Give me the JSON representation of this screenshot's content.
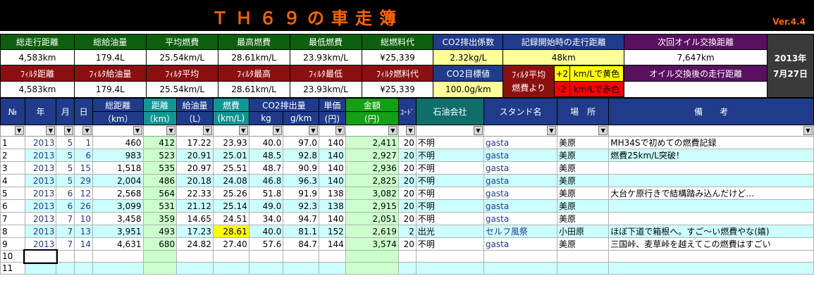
{
  "title": "ＴＨ６９の車走簿",
  "version": "Ver.4.4",
  "summary": {
    "row1": [
      {
        "label": "総走行距離",
        "value": "4,583km"
      },
      {
        "label": "総給油量",
        "value": "179.4L"
      },
      {
        "label": "平均燃費",
        "value": "25.54km/L"
      },
      {
        "label": "最高燃費",
        "value": "28.61km/L"
      },
      {
        "label": "最低燃費",
        "value": "23.93km/L"
      },
      {
        "label": "総燃料代",
        "value": "¥25,339"
      },
      {
        "label": "CO2排出係数",
        "value": "2.32kg/L"
      },
      {
        "label": "記録開始時の走行距離",
        "value": "48km"
      },
      {
        "label": "次回オイル交換距離",
        "value": "7,647km"
      }
    ],
    "row2": [
      {
        "label": "ﾌｨﾙﾀ距離",
        "value": "4,583km"
      },
      {
        "label": "ﾌｨﾙﾀ給油量",
        "value": "179.4L"
      },
      {
        "label": "ﾌｨﾙﾀ平均",
        "value": "25.54km/L"
      },
      {
        "label": "ﾌｨﾙﾀ最高",
        "value": "28.61km/L"
      },
      {
        "label": "ﾌｨﾙﾀ最低",
        "value": "23.93km/L"
      },
      {
        "label": "ﾌｨﾙﾀ燃料代",
        "value": "¥25,339"
      },
      {
        "label": "CO2目標値",
        "value": "100.0g/km"
      },
      {
        "label": "オイル交換後の走行距離",
        "value": ""
      }
    ],
    "deviation": {
      "line1": "ﾌｨﾙﾀ平均",
      "line2": "燃費より",
      "plus": "+2",
      "plus_text": "km/Lで黄色",
      "minus": "-2",
      "minus_text": "km/Lで赤色"
    },
    "date_line1": "2013年",
    "date_line2": "7月27日"
  },
  "colors": {
    "title": "#ff6600",
    "header_blue": "#1f3b8a",
    "summary_green": "#0d5f0d",
    "summary_red": "#8b1010",
    "highlight_yellow": "#ffff00",
    "row_cyan": "#ccffff"
  },
  "columns": {
    "no": "№",
    "year": "年",
    "month": "月",
    "day": "日",
    "total_dist": "総距離",
    "total_dist_unit": "（km）",
    "dist": "距離",
    "dist_unit": "（km）",
    "fuel": "給油量",
    "fuel_unit": "（L）",
    "economy": "燃費",
    "economy_unit": "(km/L)",
    "co2": "CO2排出量",
    "co2_kg": "kg",
    "co2_gkm": "g/km",
    "price": "単価",
    "price_unit": "(円)",
    "amount": "金額",
    "amount_unit": "(円)",
    "code": "ｺｰﾄﾞ",
    "company": "石油会社",
    "stand": "スタンド名",
    "place": "場　所",
    "note": "備　　考"
  },
  "rows": [
    {
      "no": "1",
      "year": "2013",
      "month": "5",
      "day": "1",
      "total": "460",
      "dist": "412",
      "fuel": "17.22",
      "eco": "23.93",
      "kg": "40.0",
      "gkm": "97.0",
      "price": "140",
      "amount": "2,411",
      "code": "20",
      "company": "不明",
      "stand": "gasta",
      "place": "美原",
      "note": "MH34Sで初めての燃費記録"
    },
    {
      "no": "2",
      "year": "2013",
      "month": "5",
      "day": "6",
      "total": "983",
      "dist": "523",
      "fuel": "20.91",
      "eco": "25.01",
      "kg": "48.5",
      "gkm": "92.8",
      "price": "140",
      "amount": "2,927",
      "code": "20",
      "company": "不明",
      "stand": "gasta",
      "place": "美原",
      "note": "燃費25km/L突破！"
    },
    {
      "no": "3",
      "year": "2013",
      "month": "5",
      "day": "15",
      "total": "1,518",
      "dist": "535",
      "fuel": "20.97",
      "eco": "25.51",
      "kg": "48.7",
      "gkm": "90.9",
      "price": "140",
      "amount": "2,936",
      "code": "20",
      "company": "不明",
      "stand": "gasta",
      "place": "美原",
      "note": ""
    },
    {
      "no": "4",
      "year": "2013",
      "month": "5",
      "day": "29",
      "total": "2,004",
      "dist": "486",
      "fuel": "20.18",
      "eco": "24.08",
      "kg": "46.8",
      "gkm": "96.3",
      "price": "140",
      "amount": "2,825",
      "code": "20",
      "company": "不明",
      "stand": "gasta",
      "place": "美原",
      "note": ""
    },
    {
      "no": "5",
      "year": "2013",
      "month": "6",
      "day": "12",
      "total": "2,568",
      "dist": "564",
      "fuel": "22.33",
      "eco": "25.26",
      "kg": "51.8",
      "gkm": "91.9",
      "price": "138",
      "amount": "3,082",
      "code": "20",
      "company": "不明",
      "stand": "gasta",
      "place": "美原",
      "note": "大台ケ原行きで結構踏み込んだけど…"
    },
    {
      "no": "6",
      "year": "2013",
      "month": "6",
      "day": "26",
      "total": "3,099",
      "dist": "531",
      "fuel": "21.12",
      "eco": "25.14",
      "kg": "49.0",
      "gkm": "92.3",
      "price": "138",
      "amount": "2,915",
      "code": "20",
      "company": "不明",
      "stand": "gasta",
      "place": "美原",
      "note": ""
    },
    {
      "no": "7",
      "year": "2013",
      "month": "7",
      "day": "10",
      "total": "3,458",
      "dist": "359",
      "fuel": "14.65",
      "eco": "24.51",
      "kg": "34.0",
      "gkm": "94.7",
      "price": "140",
      "amount": "2,051",
      "code": "20",
      "company": "不明",
      "stand": "gasta",
      "place": "美原",
      "note": ""
    },
    {
      "no": "8",
      "year": "2013",
      "month": "7",
      "day": "13",
      "total": "3,951",
      "dist": "493",
      "fuel": "17.23",
      "eco": "28.61",
      "kg": "40.0",
      "gkm": "81.1",
      "price": "152",
      "amount": "2,619",
      "code": "2",
      "company": "出光",
      "stand": "セルフ風祭",
      "place": "小田原",
      "note": "ほぼ下道で箱根へ。すご～い燃費やな(嬉)"
    },
    {
      "no": "9",
      "year": "2013",
      "month": "7",
      "day": "14",
      "total": "4,631",
      "dist": "680",
      "fuel": "24.82",
      "eco": "27.40",
      "kg": "57.6",
      "gkm": "84.7",
      "price": "144",
      "amount": "3,574",
      "code": "20",
      "company": "不明",
      "stand": "gasta",
      "place": "美原",
      "note": "三国峠、麦草峠を越えてこの燃費はすごい"
    }
  ],
  "empty_rows": [
    "10",
    "11"
  ]
}
